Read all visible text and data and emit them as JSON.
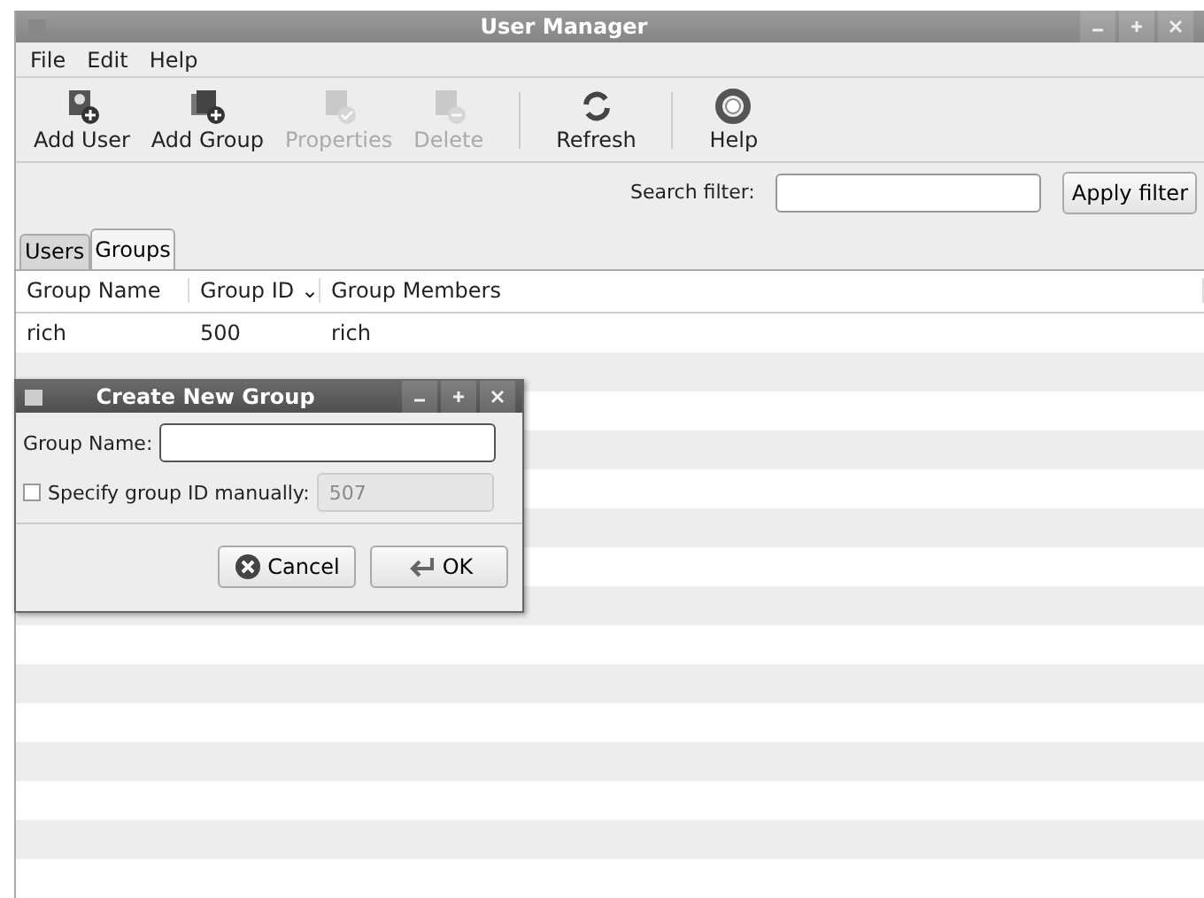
{
  "window": {
    "title": "User Manager"
  },
  "menu": [
    "File",
    "Edit",
    "Help"
  ],
  "toolbar": [
    {
      "kind": "button",
      "label": "Add User",
      "disabled": false
    },
    {
      "kind": "button",
      "label": "Add Group",
      "disabled": false
    },
    {
      "kind": "button",
      "label": "Properties",
      "disabled": true
    },
    {
      "kind": "button",
      "label": "Delete",
      "disabled": true
    },
    {
      "kind": "separator"
    },
    {
      "kind": "button",
      "label": "Refresh",
      "disabled": false
    },
    {
      "kind": "separator"
    },
    {
      "kind": "button",
      "label": "Help",
      "disabled": false
    }
  ],
  "search": {
    "label": "Search filter:",
    "button": "Apply filter"
  },
  "tabs": [
    {
      "label": "Users",
      "selected": false
    },
    {
      "label": "Groups",
      "selected": true
    }
  ],
  "table": {
    "columns": [
      "Group Name",
      "Group ID",
      "Group Members"
    ],
    "sort_caret": "⌄",
    "rows": [
      [
        "rich",
        "500",
        "rich"
      ]
    ]
  },
  "dialog": {
    "title": "Create New Group",
    "name_label": "Group Name:",
    "id_label": "Specify group ID manually:",
    "id_checked": false,
    "id_value": "507",
    "cancel": "Cancel",
    "ok": "OK"
  }
}
